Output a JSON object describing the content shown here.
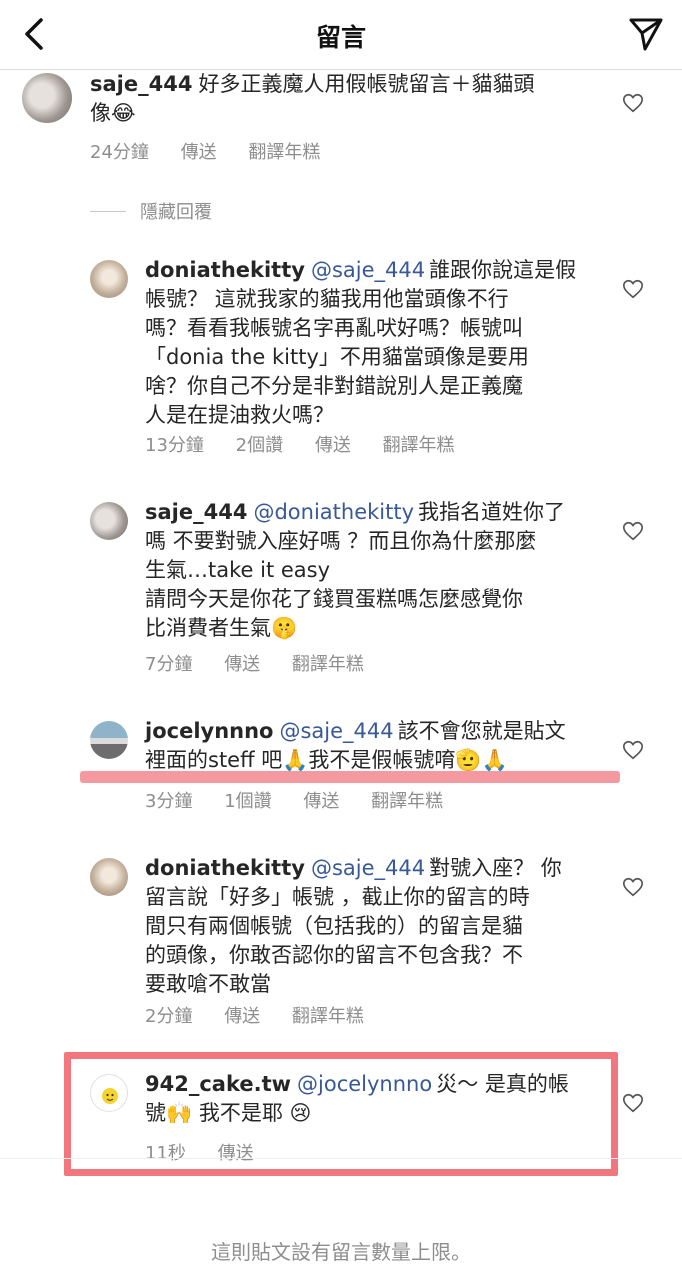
{
  "header": {
    "title": "留言",
    "back_icon": "chevron-left-icon",
    "send_icon": "paper-plane-icon"
  },
  "comments": [
    {
      "username": "saje_444",
      "mention": "",
      "lines": [
        "好多正義魔人用假帳號留言＋貓貓頭",
        "像😂"
      ],
      "time": "24分鐘",
      "likes": "",
      "reply": "傳送",
      "translate": "翻譯年糕"
    },
    {
      "username": "doniathekitty",
      "mention": "@saje_444",
      "lines": [
        "誰跟你說這是假",
        "帳號？ 這就我家的貓我用他當頭像不行",
        "嗎？看看我帳號名字再亂吠好嗎？帳號叫",
        "「donia the kitty」不用貓當頭像是要用",
        "啥？你自己不分是非對錯說別人是正義魔",
        "人是在提油救火嗎？"
      ],
      "time": "13分鐘",
      "likes": "2個讚",
      "reply": "傳送",
      "translate": "翻譯年糕"
    },
    {
      "username": "saje_444",
      "mention": "@doniathekitty",
      "lines": [
        "我指名道姓你了",
        "嗎 不要對號入座好嗎 ？而且你為什麼那麼",
        "生氣…take it easy",
        "請問今天是你花了錢買蛋糕嗎怎麼感覺你",
        "比消費者生氣🤫"
      ],
      "time": "7分鐘",
      "likes": "",
      "reply": "傳送",
      "translate": "翻譯年糕"
    },
    {
      "username": "jocelynnno",
      "mention": "@saje_444",
      "lines": [
        "該不會您就是貼文",
        "裡面的steff 吧🙏我不是假帳號唷🫡🙏"
      ],
      "time": "3分鐘",
      "likes": "1個讚",
      "reply": "傳送",
      "translate": "翻譯年糕"
    },
    {
      "username": "doniathekitty",
      "mention": "@saje_444",
      "lines": [
        "對號入座？ 你",
        "留言說「好多」帳號 ，截止你的留言的時",
        "間只有兩個帳號（包括我的）的留言是貓",
        "的頭像，你敢否認你的留言不包含我？不",
        "要敢嗆不敢當"
      ],
      "time": "2分鐘",
      "likes": "",
      "reply": "傳送",
      "translate": "翻譯年糕"
    },
    {
      "username": "942_cake.tw",
      "mention": "@jocelynnno",
      "lines": [
        "災～ 是真的帳",
        "號🙌 我不是耶 😢"
      ],
      "time": "11秒",
      "likes": "",
      "reply": "傳送",
      "translate": ""
    }
  ],
  "hidden_replies_label": "隱藏回覆",
  "footer_text": "這則貼文設有留言數量上限。",
  "colors": {
    "mention": "#385898",
    "meta": "#8e8e8e",
    "annotation_red": "#eb4650"
  }
}
